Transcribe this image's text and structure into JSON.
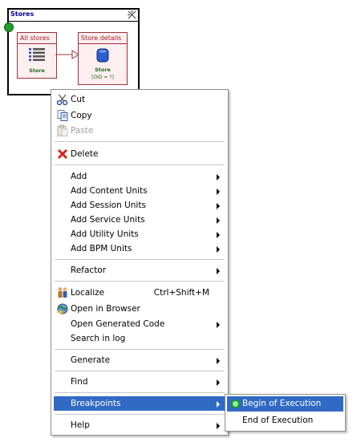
{
  "diagram": {
    "frame_title": "Stores",
    "units": [
      {
        "title": "All stores",
        "label": "Store",
        "sub": ""
      },
      {
        "title": "Store details",
        "label": "Store",
        "sub": "[OID = ?]"
      }
    ]
  },
  "menu": {
    "cut": "Cut",
    "copy": "Copy",
    "paste": "Paste",
    "delete": "Delete",
    "add": "Add",
    "add_content_units": "Add Content Units",
    "add_session_units": "Add Session Units",
    "add_service_units": "Add Service Units",
    "add_utility_units": "Add Utility Units",
    "add_bpm_units": "Add BPM Units",
    "refactor": "Refactor",
    "localize": "Localize",
    "localize_shortcut": "Ctrl+Shift+M",
    "open_in_browser": "Open in Browser",
    "open_generated_code": "Open Generated Code",
    "search_in_log": "Search in log",
    "generate": "Generate",
    "find": "Find",
    "breakpoints": "Breakpoints",
    "help": "Help"
  },
  "submenu": {
    "begin_of_execution": "Begin of Execution",
    "end_of_execution": "End of Execution"
  },
  "colors": {
    "highlight": "#316ac5",
    "unit_border": "#a0303a",
    "unit_fill": "#fdeef0",
    "label_green": "#1d6d1d"
  }
}
